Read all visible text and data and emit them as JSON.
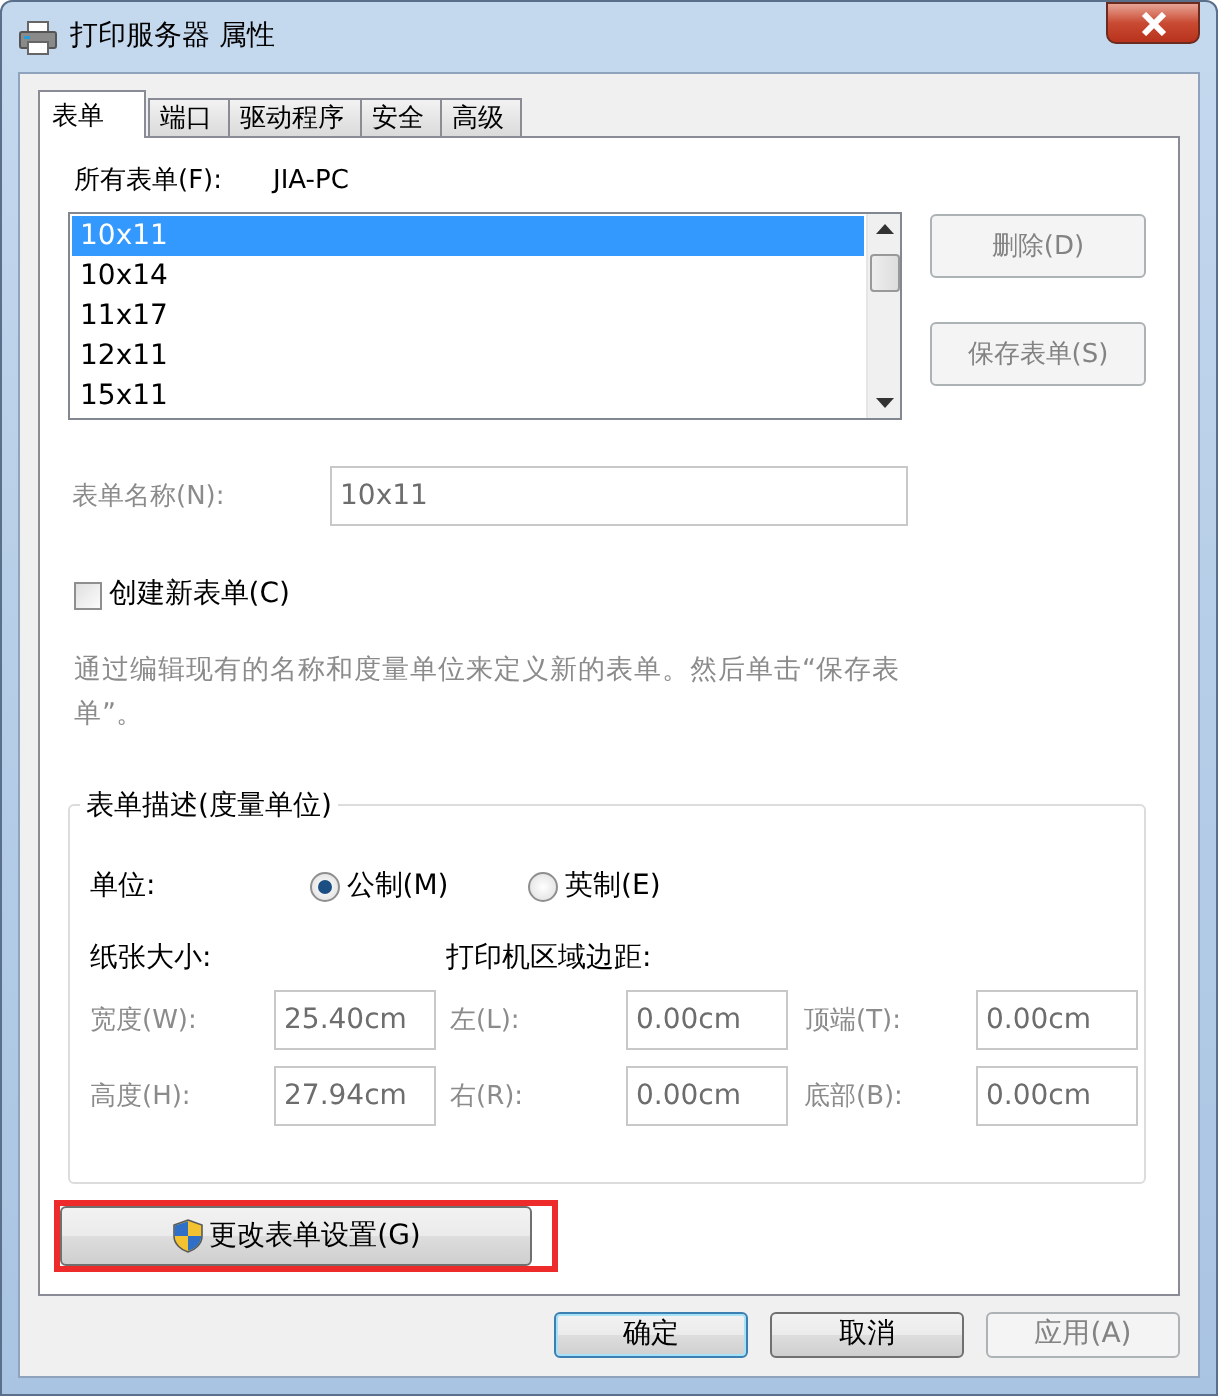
{
  "window": {
    "title": "打印服务器 属性"
  },
  "tabs": [
    {
      "label": "表单",
      "selected": true
    },
    {
      "label": "端口",
      "selected": false
    },
    {
      "label": "驱动程序",
      "selected": false
    },
    {
      "label": "安全",
      "selected": false
    },
    {
      "label": "高级",
      "selected": false
    }
  ],
  "forms_label": "所有表单(F):",
  "server_name": "JIA-PC",
  "form_list": [
    {
      "label": "10x11",
      "selected": true
    },
    {
      "label": "10x14",
      "selected": false
    },
    {
      "label": "11x17",
      "selected": false
    },
    {
      "label": "12x11",
      "selected": false
    },
    {
      "label": "15x11",
      "selected": false
    }
  ],
  "side_buttons": [
    {
      "label": "删除(D)",
      "disabled": true
    },
    {
      "label": "保存表单(S)",
      "disabled": true
    }
  ],
  "form_name": {
    "label": "表单名称(N):",
    "value": "10x11",
    "disabled": true
  },
  "create_new": {
    "label": "创建新表单(C)",
    "checked": false
  },
  "hint": "通过编辑现有的名称和度量单位来定义新的表单。然后单击“保存表单”。",
  "description_group": {
    "title": "表单描述(度量单位)",
    "unit_label": "单位:",
    "units": [
      {
        "label": "公制(M)",
        "selected": true
      },
      {
        "label": "英制(E)",
        "selected": false
      }
    ],
    "paper_size_label": "纸张大小:",
    "margins_label": "打印机区域边距:",
    "fields": [
      {
        "label": "宽度(W):",
        "value": "25.40cm"
      },
      {
        "label": "左(L):",
        "value": "0.00cm"
      },
      {
        "label": "顶端(T):",
        "value": "0.00cm"
      },
      {
        "label": "高度(H):",
        "value": "27.94cm"
      },
      {
        "label": "右(R):",
        "value": "0.00cm"
      },
      {
        "label": "底部(B):",
        "value": "0.00cm"
      }
    ],
    "disabled": true
  },
  "change_button": {
    "label": "更改表单设置(G)",
    "highlighted": true
  },
  "dialog_buttons": [
    {
      "label": "确定",
      "default": true,
      "disabled": false
    },
    {
      "label": "取消",
      "default": false,
      "disabled": false
    },
    {
      "label": "应用(A)",
      "default": false,
      "disabled": true
    }
  ]
}
